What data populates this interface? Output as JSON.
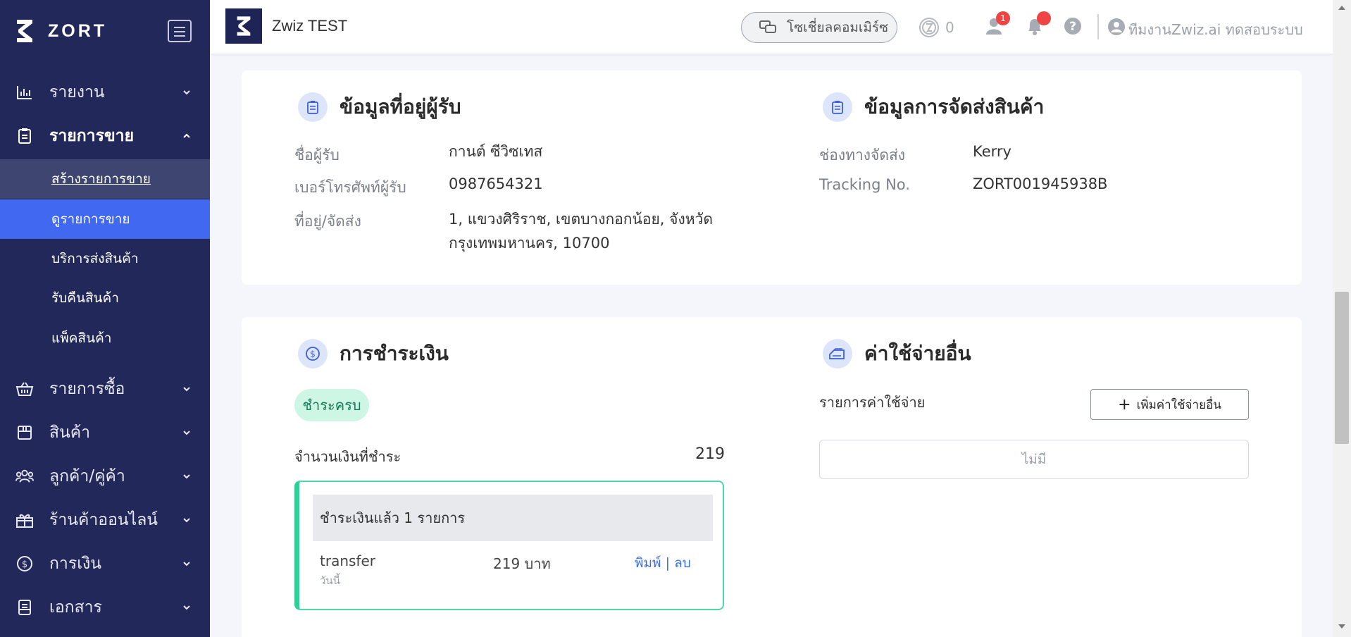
{
  "sidebar": {
    "brand": "ZORT",
    "menu": [
      {
        "label": "รายงาน",
        "icon": "bar-chart-icon"
      },
      {
        "label": "รายการขาย",
        "icon": "clipboard-icon"
      },
      {
        "label": "รายการซื้อ",
        "icon": "basket-icon"
      },
      {
        "label": "สินค้า",
        "icon": "box-icon"
      },
      {
        "label": "ลูกค้า/คู่ค้า",
        "icon": "users-icon"
      },
      {
        "label": "ร้านค้าออนไลน์",
        "icon": "gift-icon"
      },
      {
        "label": "การเงิน",
        "icon": "dollar-icon"
      },
      {
        "label": "เอกสาร",
        "icon": "document-icon"
      }
    ],
    "submenu": [
      {
        "label": "สร้างรายการขาย"
      },
      {
        "label": "ดูรายการขาย"
      },
      {
        "label": "บริการส่งสินค้า"
      },
      {
        "label": "รับคืนสินค้า"
      },
      {
        "label": "แพ็คสินค้า"
      }
    ]
  },
  "topbar": {
    "shop_name": "Zwiz TEST",
    "social_label": "โซเชี่ยลคอมเมิร์ซ",
    "coin_count": "0",
    "user_badge": "1",
    "user_name": "ทีมงานZwiz.ai ทดสอบระบบ"
  },
  "recipient": {
    "title": "ข้อมูลที่อยู่ผู้รับ",
    "name_label": "ชื่อผู้รับ",
    "name_value": "กานต์ ซีวิซเทส",
    "phone_label": "เบอร์โทรศัพท์ผู้รับ",
    "phone_value": "0987654321",
    "address_label": "ที่อยู่/จัดส่ง",
    "address_line1": "1, แขวงศิริราช, เขตบางกอกน้อย, จังหวัด",
    "address_line2": "กรุงเทพมหานคร, 10700"
  },
  "shipping": {
    "title": "ข้อมูลการจัดส่งสินค้า",
    "channel_label": "ช่องทางจัดส่ง",
    "channel_value": "Kerry",
    "tracking_label": "Tracking No.",
    "tracking_value": "ZORT001945938B"
  },
  "payment": {
    "title": "การชำระเงิน",
    "status": "ชำระครบ",
    "amount_label": "จำนวนเงินที่ชำระ",
    "amount_value": "219",
    "paid_header": "ชำระเงินแล้ว 1 รายการ",
    "method": "transfer",
    "when": "วันนี้",
    "entry_amount": "219 บาท",
    "print_link": "พิมพ์",
    "separator": " | ",
    "delete_link": "ลบ"
  },
  "other_expenses": {
    "title": "ค่าใช้จ่ายอื่น",
    "list_label": "รายการค่าใช้จ่าย",
    "add_button": "เพิ่มค่าใช้จ่ายอื่น",
    "add_plus": "+",
    "empty_text": "ไม่มี"
  },
  "colors": {
    "sidebar_bg": "#22285a",
    "sidebar_selected": "#4068f0",
    "paid_green": "#2fcf97",
    "link_blue": "#3b6fe0",
    "badge_red": "#ef4444"
  }
}
